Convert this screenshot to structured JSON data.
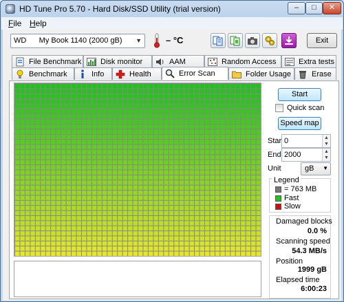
{
  "window": {
    "title": "HD Tune Pro 5.70 - Hard Disk/SSD Utility (trial version)",
    "minimize": "–",
    "maximize": "□",
    "close": "✕"
  },
  "menu": [
    "File",
    "Help"
  ],
  "toolbar": {
    "drive": "WD      My Book 1140 (2000 gB)",
    "temperature": "– °C",
    "buttons": [
      "copy-text-icon",
      "copy-screenshot-icon",
      "camera-icon",
      "options-icon",
      "save-icon"
    ],
    "exit_label": "Exit"
  },
  "tabs_top": [
    {
      "label": "File Benchmark",
      "icon": "file-benchmark-icon"
    },
    {
      "label": "Disk monitor",
      "icon": "disk-monitor-icon"
    },
    {
      "label": "AAM",
      "icon": "speaker-icon"
    },
    {
      "label": "Random Access",
      "icon": "random-access-icon"
    },
    {
      "label": "Extra tests",
      "icon": "extra-tests-icon"
    }
  ],
  "tabs_bottom": [
    {
      "label": "Benchmark",
      "icon": "lightbulb-icon"
    },
    {
      "label": "Info",
      "icon": "info-icon"
    },
    {
      "label": "Health",
      "icon": "health-cross-icon"
    },
    {
      "label": "Error Scan",
      "icon": "magnifier-icon",
      "active": true
    },
    {
      "label": "Folder Usage",
      "icon": "folder-icon"
    },
    {
      "label": "Erase",
      "icon": "trash-icon"
    }
  ],
  "scan": {
    "start_button": "Start",
    "quick_scan_label": "Quick scan",
    "quick_scan_checked": false,
    "speed_map_button": "Speed map",
    "start_label": "Start",
    "start_value": "0",
    "end_label": "End",
    "end_value": "2000",
    "unit_label": "Unit",
    "unit_value": "gB"
  },
  "legend": {
    "title": "Legend",
    "block_size": "= 763 MB",
    "fast": "Fast",
    "slow": "Slow"
  },
  "stats": {
    "damaged_label": "Damaged blocks",
    "damaged_value": "0.0 %",
    "speed_label": "Scanning speed",
    "speed_value": "54.3 MB/s",
    "position_label": "Position",
    "position_value": "1999 gB",
    "elapsed_label": "Elapsed time",
    "elapsed_value": "6:00:23"
  },
  "colors": {
    "fast_top": "#22c21e",
    "fast_bottom": "#e6e62a",
    "slow": "#cc1010",
    "block_size_swatch": "#777777",
    "button_border": "#3c7fb1"
  },
  "block_map": {
    "columns": 48,
    "rows": 34,
    "damaged_blocks": 0
  }
}
